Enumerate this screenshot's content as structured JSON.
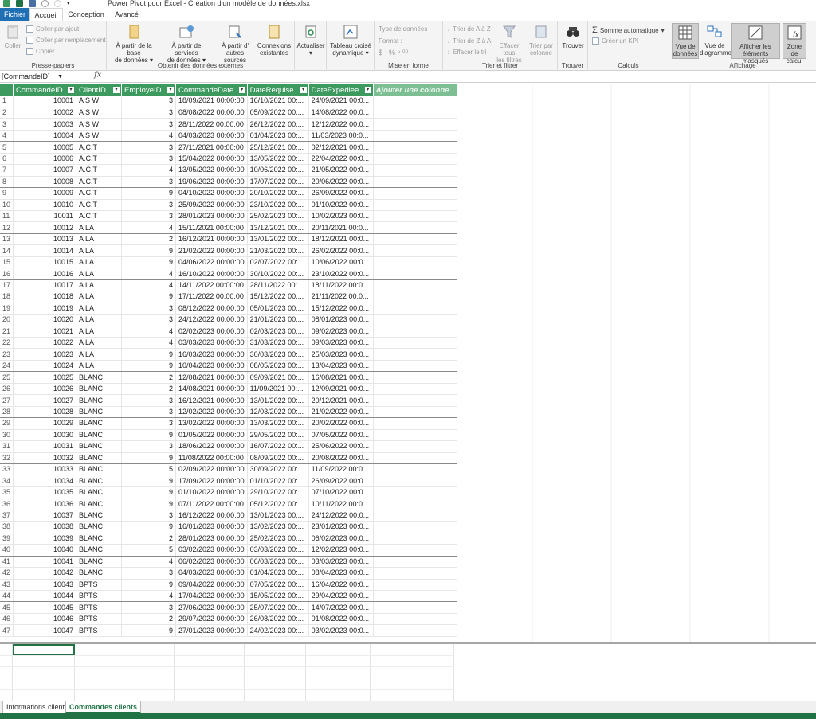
{
  "window": {
    "title": "Power Pivot pour Excel - Création d'un modèle de données.xlsx"
  },
  "menu_tabs": {
    "file": "Fichier",
    "home": "Accueil",
    "design": "Conception",
    "advanced": "Avancé"
  },
  "ribbon": {
    "clipboard": {
      "label": "Presse-papiers",
      "paste": "Coller",
      "paste_append": "Coller par ajout",
      "paste_replace": "Coller par remplacement",
      "copy": "Copier"
    },
    "external": {
      "label": "Obtenir des données externes",
      "from_db_1": "À partir de la base",
      "from_db_2": "de données",
      "from_services_1": "À partir de services",
      "from_services_2": "de données",
      "from_other_1": "À partir d'",
      "from_other_2": "autres sources",
      "existing_1": "Connexions",
      "existing_2": "existantes"
    },
    "refresh": "Actualiser",
    "pivot_1": "Tableau croisé",
    "pivot_2": "dynamique",
    "format_group": {
      "label": "Mise en forme",
      "datatype": "Type de données :",
      "format": "Format :",
      "symbols": "$ - % ⁹ ⁰⁰"
    },
    "sort": {
      "label": "Trier et filtrer",
      "sort_az": "Trier de A à Z",
      "sort_za": "Trier de Z à A",
      "clear_sort": "Effacer le tri",
      "clear_filters_1": "Effacer tous",
      "clear_filters_2": "les filtres",
      "sort_by_col_1": "Trier par",
      "sort_by_col_2": "colonne"
    },
    "find_group": {
      "label": "Trouver",
      "find": "Trouver"
    },
    "calc": {
      "label": "Calculs",
      "autosum": "Somme automatique",
      "kpi": "Créer un KPI"
    },
    "view": {
      "label": "Affichage",
      "data_view_1": "Vue de",
      "data_view_2": "données",
      "diagram_1": "Vue de",
      "diagram_2": "diagramme",
      "show_hidden_1": "Afficher les",
      "show_hidden_2": "éléments masqués",
      "calc_area_1": "Zone de",
      "calc_area_2": "calcul"
    }
  },
  "formula_bar": {
    "name_box": "[CommandeID]",
    "fx": "fx"
  },
  "table": {
    "columns": [
      "CommandeID",
      "ClientID",
      "EmployeID",
      "CommandeDate",
      "DateRequise",
      "DateExpediee"
    ],
    "add_column": "Ajouter une colonne",
    "rows": [
      [
        "1",
        "10001",
        "A S W",
        "3",
        "18/09/2021 00:00:00",
        "16/10/2021 00:...",
        "24/09/2021 00:0..."
      ],
      [
        "2",
        "10002",
        "A S W",
        "3",
        "08/08/2022 00:00:00",
        "05/09/2022 00:...",
        "14/08/2022 00:0..."
      ],
      [
        "3",
        "10003",
        "A S W",
        "3",
        "28/11/2022 00:00:00",
        "26/12/2022 00:...",
        "12/12/2022 00:0..."
      ],
      [
        "4",
        "10004",
        "A S W",
        "4",
        "04/03/2023 00:00:00",
        "01/04/2023 00:...",
        "11/03/2023 00:0..."
      ],
      [
        "5",
        "10005",
        "A.C.T",
        "3",
        "27/11/2021 00:00:00",
        "25/12/2021 00:...",
        "02/12/2021 00:0..."
      ],
      [
        "6",
        "10006",
        "A.C.T",
        "3",
        "15/04/2022 00:00:00",
        "13/05/2022 00:...",
        "22/04/2022 00:0..."
      ],
      [
        "7",
        "10007",
        "A.C.T",
        "4",
        "13/05/2022 00:00:00",
        "10/06/2022 00:...",
        "21/05/2022 00:0..."
      ],
      [
        "8",
        "10008",
        "A.C.T",
        "3",
        "19/06/2022 00:00:00",
        "17/07/2022 00:...",
        "20/06/2022 00:0..."
      ],
      [
        "9",
        "10009",
        "A.C.T",
        "9",
        "04/10/2022 00:00:00",
        "20/10/2022 00:...",
        "26/09/2022 00:0..."
      ],
      [
        "10",
        "10010",
        "A.C.T",
        "3",
        "25/09/2022 00:00:00",
        "23/10/2022 00:...",
        "01/10/2022 00:0..."
      ],
      [
        "11",
        "10011",
        "A.C.T",
        "3",
        "28/01/2023 00:00:00",
        "25/02/2023 00:...",
        "10/02/2023 00:0..."
      ],
      [
        "12",
        "10012",
        "A LA",
        "4",
        "15/11/2021 00:00:00",
        "13/12/2021 00:...",
        "20/11/2021 00:0..."
      ],
      [
        "13",
        "10013",
        "A LA",
        "2",
        "16/12/2021 00:00:00",
        "13/01/2022 00:...",
        "18/12/2021 00:0..."
      ],
      [
        "14",
        "10014",
        "A LA",
        "9",
        "21/02/2022 00:00:00",
        "21/03/2022 00:...",
        "26/02/2022 00:0..."
      ],
      [
        "15",
        "10015",
        "A LA",
        "9",
        "04/06/2022 00:00:00",
        "02/07/2022 00:...",
        "10/06/2022 00:0..."
      ],
      [
        "16",
        "10016",
        "A LA",
        "4",
        "16/10/2022 00:00:00",
        "30/10/2022 00:...",
        "23/10/2022 00:0..."
      ],
      [
        "17",
        "10017",
        "A LA",
        "4",
        "14/11/2022 00:00:00",
        "28/11/2022 00:...",
        "18/11/2022 00:0..."
      ],
      [
        "18",
        "10018",
        "A LA",
        "9",
        "17/11/2022 00:00:00",
        "15/12/2022 00:...",
        "21/11/2022 00:0..."
      ],
      [
        "19",
        "10019",
        "A LA",
        "3",
        "08/12/2022 00:00:00",
        "05/01/2023 00:...",
        "15/12/2022 00:0..."
      ],
      [
        "20",
        "10020",
        "A LA",
        "3",
        "24/12/2022 00:00:00",
        "21/01/2023 00:...",
        "08/01/2023 00:0..."
      ],
      [
        "21",
        "10021",
        "A LA",
        "4",
        "02/02/2023 00:00:00",
        "02/03/2023 00:...",
        "09/02/2023 00:0..."
      ],
      [
        "22",
        "10022",
        "A LA",
        "4",
        "03/03/2023 00:00:00",
        "31/03/2023 00:...",
        "09/03/2023 00:0..."
      ],
      [
        "23",
        "10023",
        "A LA",
        "9",
        "16/03/2023 00:00:00",
        "30/03/2023 00:...",
        "25/03/2023 00:0..."
      ],
      [
        "24",
        "10024",
        "A LA",
        "9",
        "10/04/2023 00:00:00",
        "08/05/2023 00:...",
        "13/04/2023 00:0..."
      ],
      [
        "25",
        "10025",
        "BLANC",
        "2",
        "12/08/2021 00:00:00",
        "09/09/2021 00:...",
        "16/08/2021 00:0..."
      ],
      [
        "26",
        "10026",
        "BLANC",
        "2",
        "14/08/2021 00:00:00",
        "11/09/2021 00:...",
        "12/09/2021 00:0..."
      ],
      [
        "27",
        "10027",
        "BLANC",
        "3",
        "16/12/2021 00:00:00",
        "13/01/2022 00:...",
        "20/12/2021 00:0..."
      ],
      [
        "28",
        "10028",
        "BLANC",
        "3",
        "12/02/2022 00:00:00",
        "12/03/2022 00:...",
        "21/02/2022 00:0..."
      ],
      [
        "29",
        "10029",
        "BLANC",
        "3",
        "13/02/2022 00:00:00",
        "13/03/2022 00:...",
        "20/02/2022 00:0..."
      ],
      [
        "30",
        "10030",
        "BLANC",
        "9",
        "01/05/2022 00:00:00",
        "29/05/2022 00:...",
        "07/05/2022 00:0..."
      ],
      [
        "31",
        "10031",
        "BLANC",
        "3",
        "18/06/2022 00:00:00",
        "16/07/2022 00:...",
        "25/06/2022 00:0..."
      ],
      [
        "32",
        "10032",
        "BLANC",
        "9",
        "11/08/2022 00:00:00",
        "08/09/2022 00:...",
        "20/08/2022 00:0..."
      ],
      [
        "33",
        "10033",
        "BLANC",
        "5",
        "02/09/2022 00:00:00",
        "30/09/2022 00:...",
        "11/09/2022 00:0..."
      ],
      [
        "34",
        "10034",
        "BLANC",
        "9",
        "17/09/2022 00:00:00",
        "01/10/2022 00:...",
        "26/09/2022 00:0..."
      ],
      [
        "35",
        "10035",
        "BLANC",
        "9",
        "01/10/2022 00:00:00",
        "29/10/2022 00:...",
        "07/10/2022 00:0..."
      ],
      [
        "36",
        "10036",
        "BLANC",
        "9",
        "07/11/2022 00:00:00",
        "05/12/2022 00:...",
        "10/11/2022 00:0..."
      ],
      [
        "37",
        "10037",
        "BLANC",
        "3",
        "16/12/2022 00:00:00",
        "13/01/2023 00:...",
        "24/12/2022 00:0..."
      ],
      [
        "38",
        "10038",
        "BLANC",
        "9",
        "16/01/2023 00:00:00",
        "13/02/2023 00:...",
        "23/01/2023 00:0..."
      ],
      [
        "39",
        "10039",
        "BLANC",
        "2",
        "28/01/2023 00:00:00",
        "25/02/2023 00:...",
        "06/02/2023 00:0..."
      ],
      [
        "40",
        "10040",
        "BLANC",
        "5",
        "03/02/2023 00:00:00",
        "03/03/2023 00:...",
        "12/02/2023 00:0..."
      ],
      [
        "41",
        "10041",
        "BLANC",
        "4",
        "06/02/2023 00:00:00",
        "06/03/2023 00:...",
        "03/03/2023 00:0..."
      ],
      [
        "42",
        "10042",
        "BLANC",
        "3",
        "04/03/2023 00:00:00",
        "01/04/2023 00:...",
        "08/04/2023 00:0..."
      ],
      [
        "43",
        "10043",
        "BPTS",
        "9",
        "09/04/2022 00:00:00",
        "07/05/2022 00:...",
        "16/04/2022 00:0..."
      ],
      [
        "44",
        "10044",
        "BPTS",
        "4",
        "17/04/2022 00:00:00",
        "15/05/2022 00:...",
        "29/04/2022 00:0..."
      ],
      [
        "45",
        "10045",
        "BPTS",
        "3",
        "27/06/2022 00:00:00",
        "25/07/2022 00:...",
        "14/07/2022 00:0..."
      ],
      [
        "46",
        "10046",
        "BPTS",
        "2",
        "29/07/2022 00:00:00",
        "26/08/2022 00:...",
        "01/08/2022 00:0..."
      ],
      [
        "47",
        "10047",
        "BPTS",
        "9",
        "27/01/2023 00:00:00",
        "24/02/2023 00:...",
        "03/02/2023 00:0..."
      ]
    ]
  },
  "sheet_tabs": [
    "Informations clients",
    "Commandes clients"
  ],
  "colors": {
    "header_green": "#3c9a5f",
    "accent_green": "#217346",
    "file_tab_blue": "#1f6fb5"
  }
}
